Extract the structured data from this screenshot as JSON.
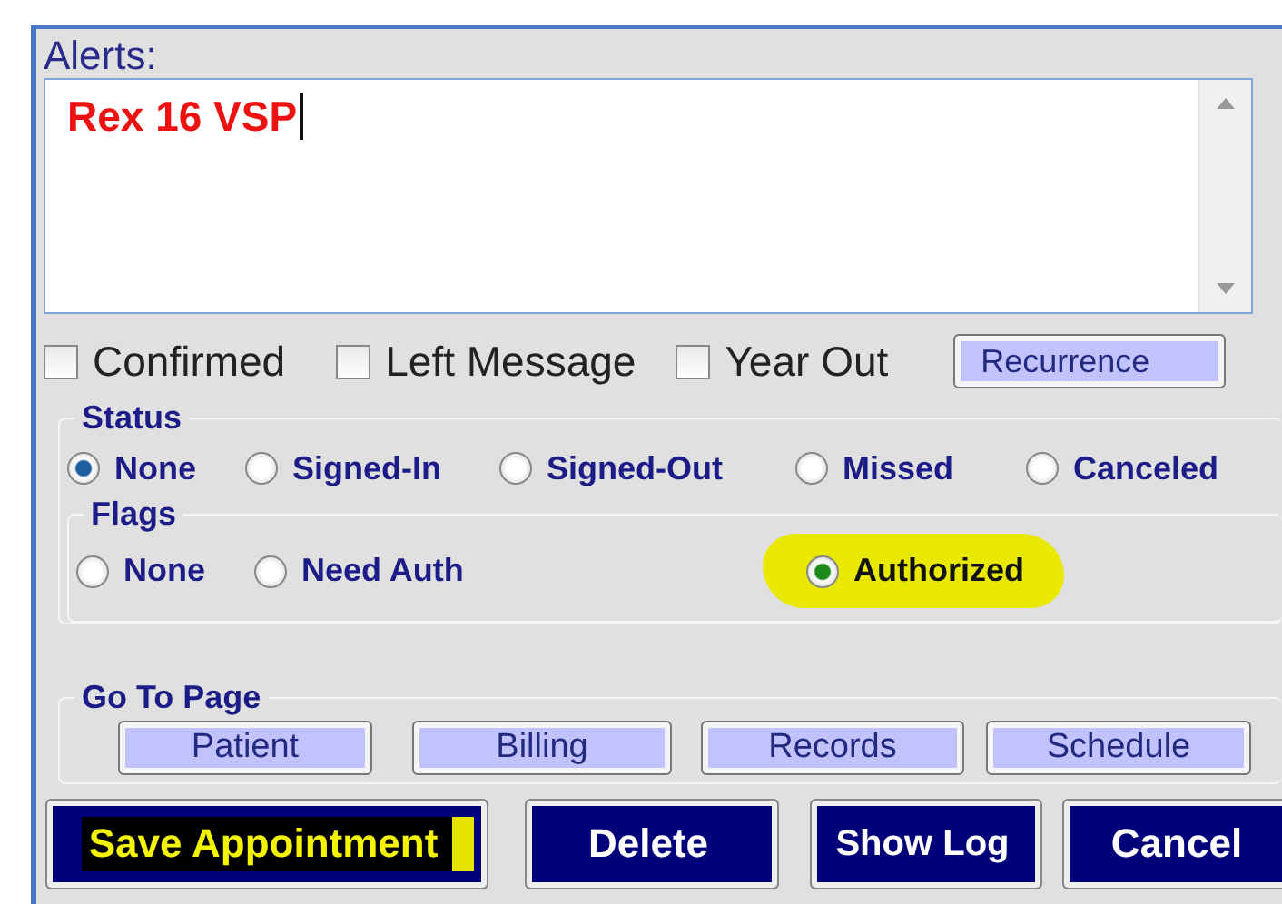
{
  "alerts": {
    "label": "Alerts:",
    "value": "Rex 16 VSP"
  },
  "checks": [
    {
      "label": "Confirmed",
      "checked": false
    },
    {
      "label": "Left Message",
      "checked": false
    },
    {
      "label": "Year Out",
      "checked": false
    }
  ],
  "recurrence_button": "Recurrence",
  "status": {
    "title": "Status",
    "options": [
      {
        "label": "None",
        "selected": true
      },
      {
        "label": "Signed-In",
        "selected": false
      },
      {
        "label": "Signed-Out",
        "selected": false
      },
      {
        "label": "Missed",
        "selected": false
      },
      {
        "label": "Canceled",
        "selected": false
      }
    ]
  },
  "flags": {
    "title": "Flags",
    "options": [
      {
        "label": "None",
        "selected": false,
        "highlighted": false
      },
      {
        "label": "Need Auth",
        "selected": false,
        "highlighted": false
      },
      {
        "label": "Authorized",
        "selected": true,
        "highlighted": true
      }
    ]
  },
  "go_to_page": {
    "title": "Go To Page",
    "buttons": [
      "Patient",
      "Billing",
      "Records",
      "Schedule"
    ]
  },
  "actions": [
    {
      "label": "Save Appointment",
      "highlighted": true
    },
    {
      "label": "Delete",
      "highlighted": false
    },
    {
      "label": "Show Log",
      "highlighted": false
    },
    {
      "label": "Cancel",
      "highlighted": false
    }
  ]
}
